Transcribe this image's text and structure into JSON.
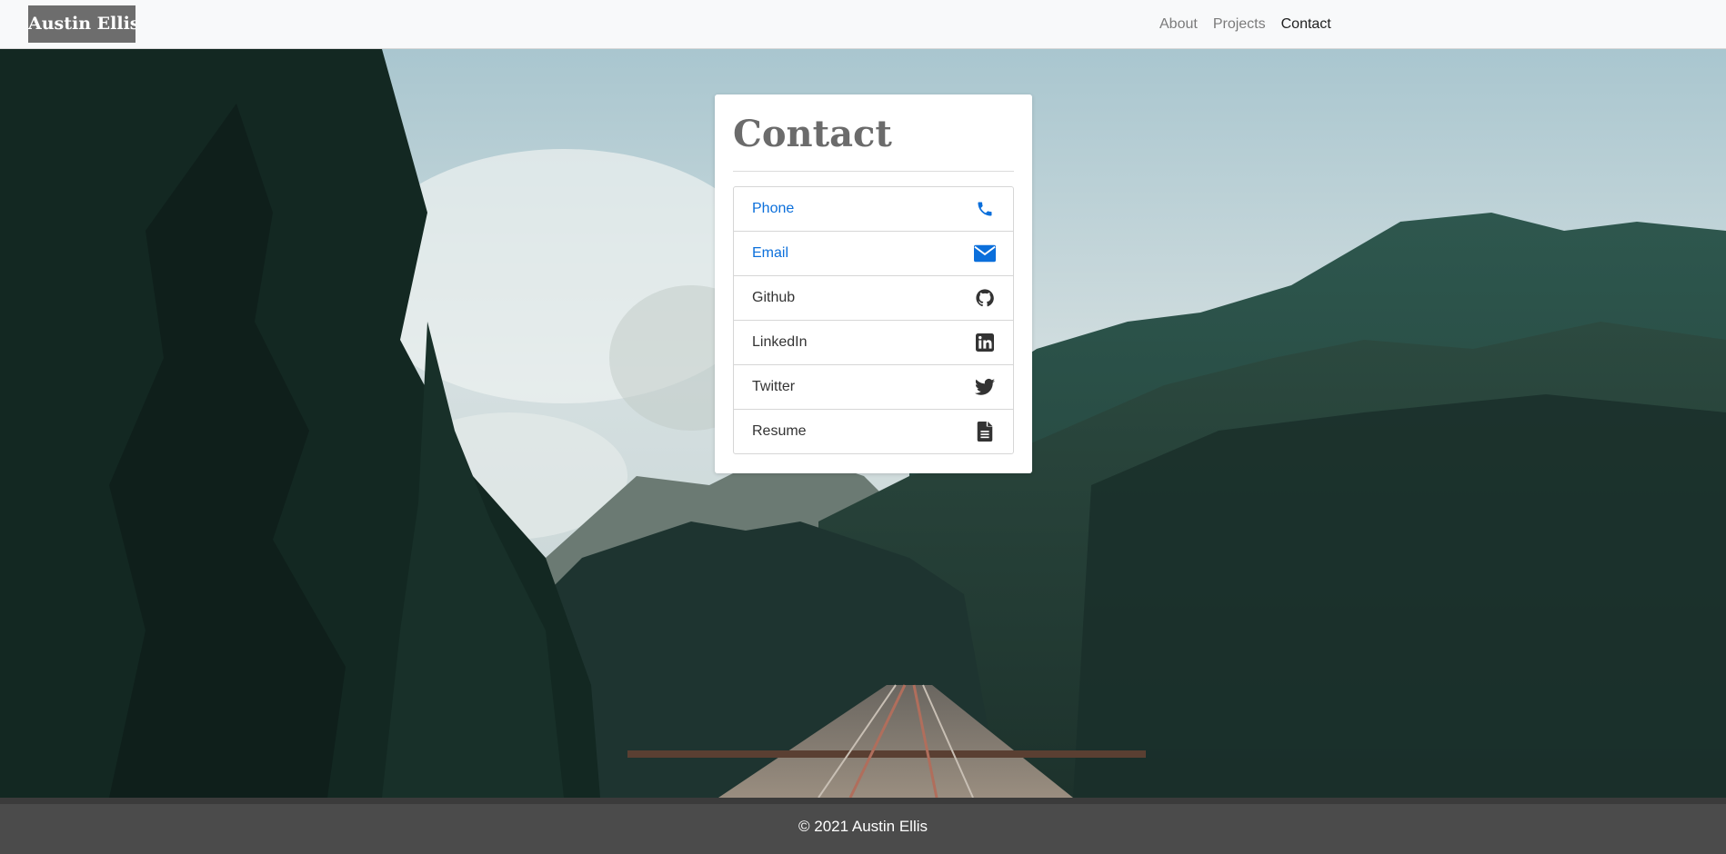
{
  "navbar": {
    "brand": "Austin Ellis",
    "links": [
      {
        "label": "About",
        "active": false
      },
      {
        "label": "Projects",
        "active": false
      },
      {
        "label": "Contact",
        "active": true
      }
    ]
  },
  "contact": {
    "title": "Contact",
    "items": [
      {
        "label": "Phone",
        "icon": "phone-icon"
      },
      {
        "label": "Email",
        "icon": "envelope-icon"
      },
      {
        "label": "Github",
        "icon": "github-icon"
      },
      {
        "label": "LinkedIn",
        "icon": "linkedin-icon"
      },
      {
        "label": "Twitter",
        "icon": "twitter-icon"
      },
      {
        "label": "Resume",
        "icon": "file-icon"
      }
    ]
  },
  "footer": {
    "text": "© 2021 Austin Ellis"
  },
  "colors": {
    "link_blue": "#0b6fdb",
    "navbar_bg": "#f8f9fa",
    "footer_bg": "#4b4b4b",
    "brand_bg": "#6d6d6d"
  }
}
